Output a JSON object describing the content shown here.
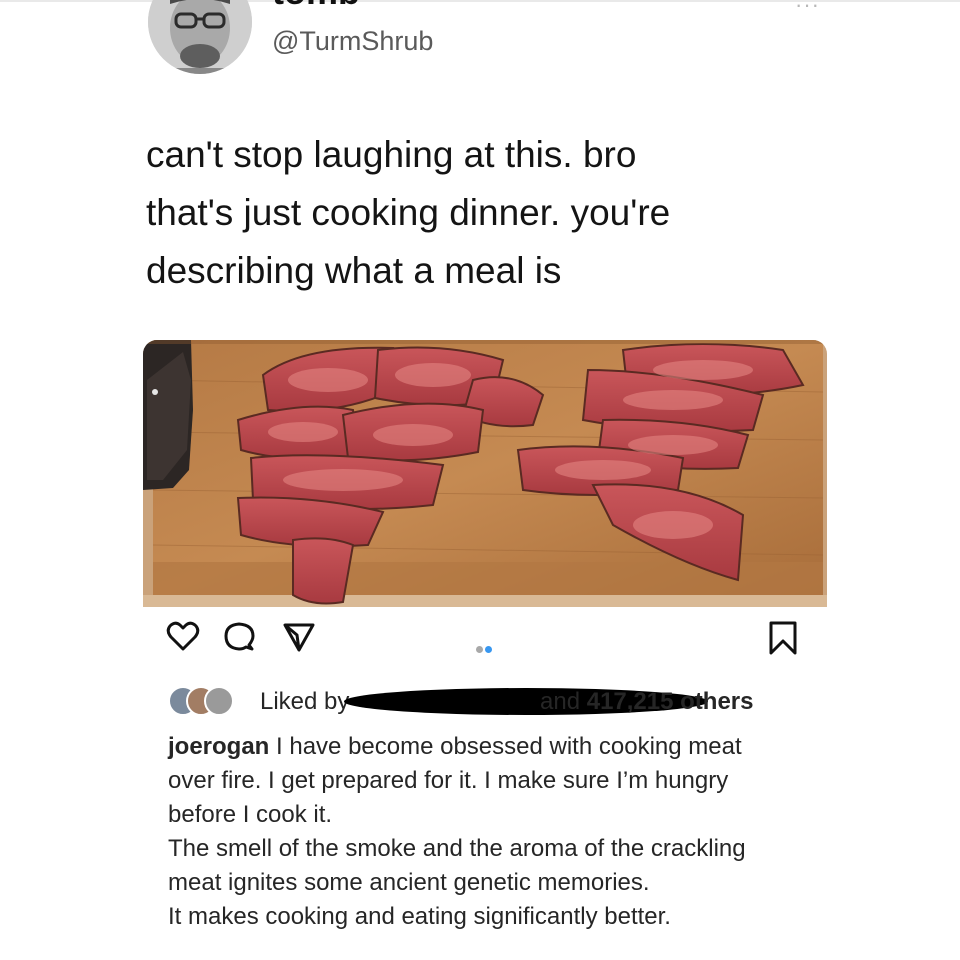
{
  "tweet": {
    "display_name": "tomb",
    "handle": "@TurmShrub",
    "text_lines": [
      "can't stop laughing at this. bro",
      "that's just cooking dinner. you're",
      "describing what a meal is"
    ]
  },
  "post": {
    "image_alt": "sliced steak on a wooden cutting board",
    "actions": {
      "like_icon": "heart-icon",
      "comment_icon": "comment-icon",
      "share_icon": "send-icon",
      "save_icon": "bookmark-icon"
    },
    "carousel": {
      "count": 2,
      "active_index": 1,
      "active_color": "#3897f0",
      "inactive_color": "#a8a8a8"
    },
    "likes": {
      "prefix": "Liked by",
      "suffix_pre": "and",
      "count_text": "417,215 others"
    },
    "caption": {
      "username": "joerogan",
      "lines": [
        "I have become obsessed with cooking meat",
        "over fire.  I get prepared for it.  I make sure I’m hungry",
        "before I cook it.",
        "The smell of the smoke and the aroma of the crackling",
        "meat ignites some ancient genetic memories.",
        "It makes cooking and eating significantly better."
      ]
    }
  }
}
